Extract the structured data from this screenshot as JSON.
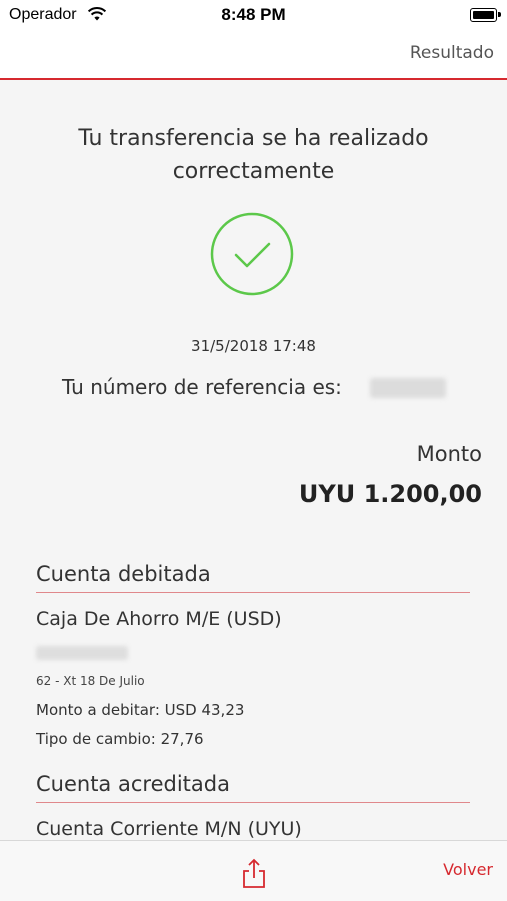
{
  "status_bar": {
    "carrier": "Operador",
    "time": "8:48 PM"
  },
  "nav": {
    "title": "Resultado"
  },
  "result": {
    "message": "Tu transferencia se ha realizado correctamente",
    "datetime": "31/5/2018 17:48",
    "reference_label": "Tu número de referencia es:",
    "amount_label": "Monto",
    "amount_value": "UYU 1.200,00"
  },
  "debited": {
    "section_title": "Cuenta debitada",
    "account_name": "Caja De Ahorro M/E (USD)",
    "branch": "62 - Xt 18 De Julio",
    "debit_amount": "Monto a debitar: USD 43,23",
    "exchange_rate": "Tipo de cambio: 27,76"
  },
  "credited": {
    "section_title": "Cuenta acreditada",
    "account_name": "Cuenta Corriente M/N (UYU)"
  },
  "toolbar": {
    "share_icon": "share-icon",
    "back_label": "Volver"
  },
  "colors": {
    "accent": "#d6292f",
    "success": "#5cc84a"
  }
}
